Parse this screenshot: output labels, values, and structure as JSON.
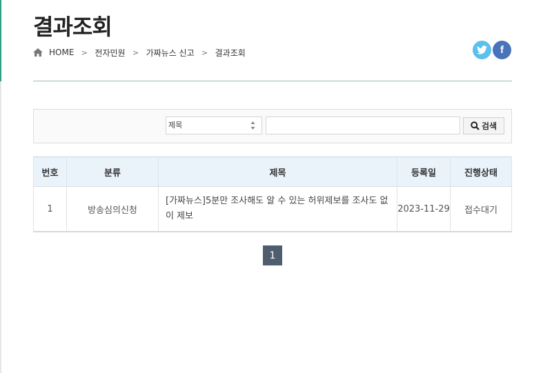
{
  "page": {
    "title": "결과조회"
  },
  "breadcrumb": {
    "items": [
      "HOME",
      "전자민원",
      "가짜뉴스 신고",
      "결과조회"
    ],
    "separator": ">"
  },
  "social": {
    "twitter_icon": "twitter-icon",
    "facebook_label": "f"
  },
  "search": {
    "select_value": "제목",
    "input_value": "",
    "button_label": "검색"
  },
  "table": {
    "headers": [
      "번호",
      "분류",
      "제목",
      "등록일",
      "진행상태"
    ],
    "rows": [
      {
        "no": "1",
        "category": "방송심의신청",
        "title": "[가짜뉴스]5분만 조사해도 알 수 있는 허위제보를 조사도 없이 제보",
        "date": "2023-11-29",
        "status": "접수대기"
      }
    ]
  },
  "pagination": {
    "current": "1"
  },
  "colors": {
    "accent": "#2c9f80",
    "header_bg": "#eaf2fa",
    "page_btn": "#4e5e6f",
    "twitter": "#5bc0eb",
    "facebook": "#4a74b9"
  }
}
